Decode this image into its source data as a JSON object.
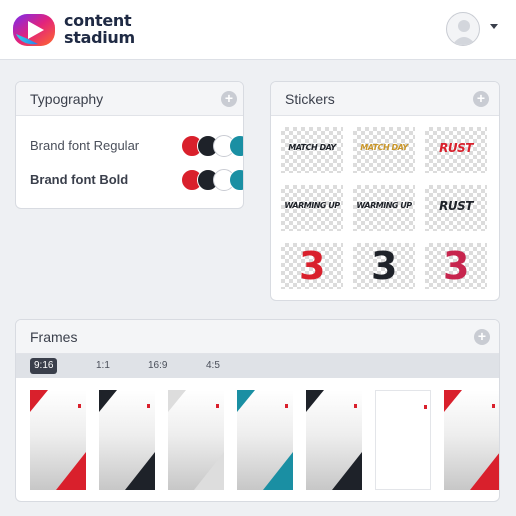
{
  "app": {
    "brand_line1": "content",
    "brand_line2": "stadium",
    "logo_icon": "play-logo-icon",
    "avatar_icon": "user-avatar-icon",
    "menu_icon": "chevron-down-icon"
  },
  "typography": {
    "title": "Typography",
    "add_icon": "plus-icon",
    "fonts": [
      {
        "label": "Brand font Regular",
        "colors": [
          "#d9202c",
          "#1e2229",
          "#ffffff",
          "#1a8fa3"
        ]
      },
      {
        "label": "Brand font Bold",
        "colors": [
          "#d9202c",
          "#1e2229",
          "#ffffff",
          "#1a8fa3"
        ]
      }
    ]
  },
  "stickers": {
    "title": "Stickers",
    "add_icon": "plus-icon",
    "items": [
      {
        "text": "MATCH DAY",
        "color": "#1e2229"
      },
      {
        "text": "MATCH DAY",
        "color": "#c9962a"
      },
      {
        "text": "RUST",
        "color": "#d9202c"
      },
      {
        "text": "WARMING UP",
        "color": "#1e2229"
      },
      {
        "text": "WARMING UP",
        "color": "#1e2229"
      },
      {
        "text": "RUST",
        "color": "#1e2229"
      },
      {
        "text": "3",
        "color": "#d9202c"
      },
      {
        "text": "3",
        "color": "#1e2229"
      },
      {
        "text": "3",
        "color": "#c7254e"
      }
    ]
  },
  "frames": {
    "title": "Frames",
    "add_icon": "plus-icon",
    "ratios": [
      "9:16",
      "1:1",
      "16:9",
      "4:5"
    ],
    "selected_ratio": "9:16",
    "accents": [
      "#d9202c",
      "#1e2229",
      "#dddddd",
      "#1a8fa3",
      "#1e2229",
      "#ffffff",
      "#d9202c"
    ]
  }
}
